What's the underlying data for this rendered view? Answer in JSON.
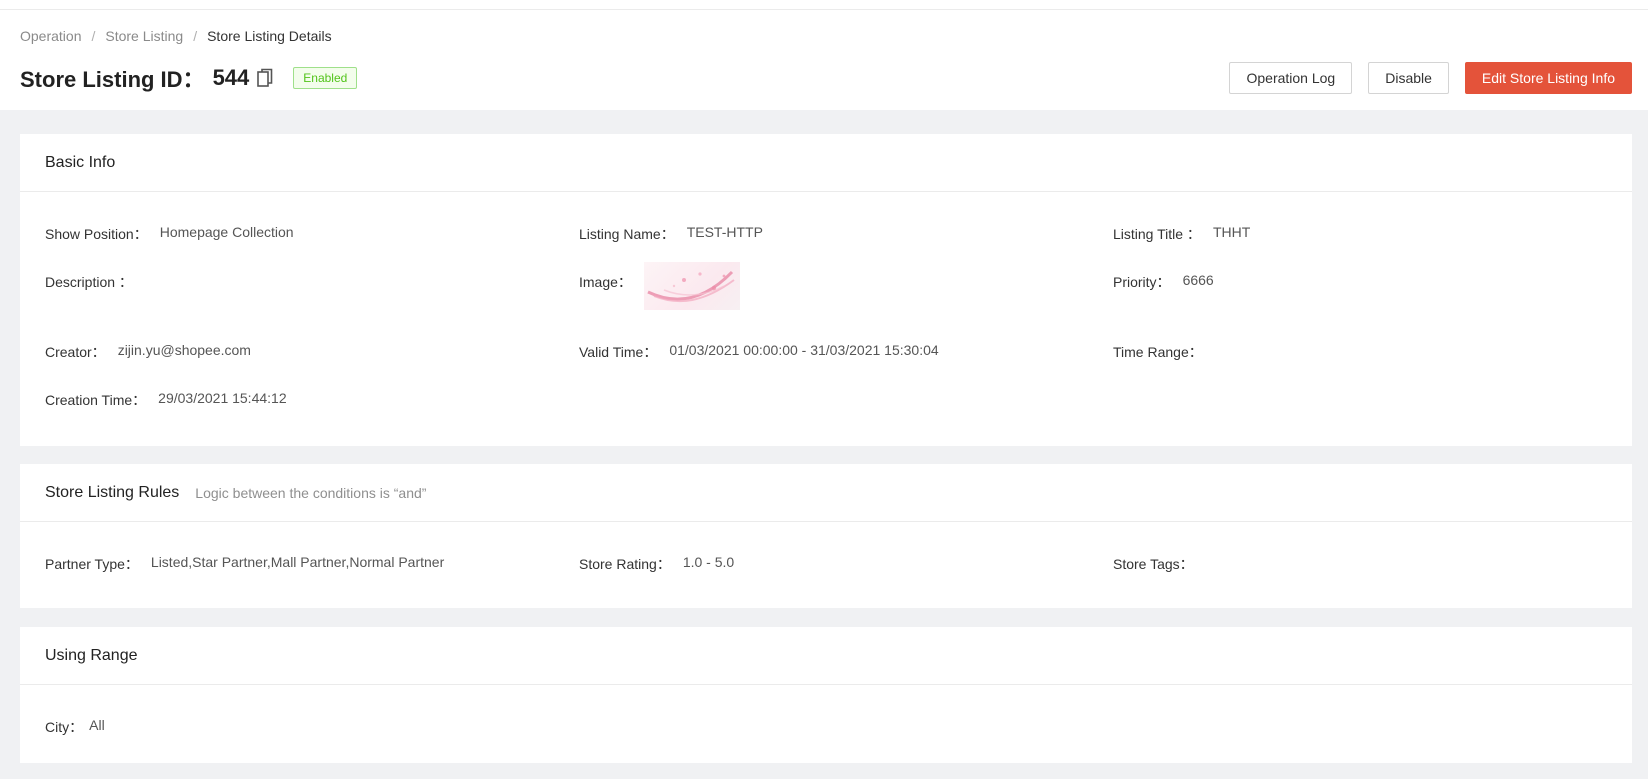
{
  "breadcrumb": {
    "items": [
      "Operation",
      "Store Listing"
    ],
    "separator": "/",
    "current": "Store Listing Details"
  },
  "header": {
    "title_label": "Store Listing ID：",
    "listing_id": "544",
    "status": "Enabled",
    "actions": {
      "operation_log": "Operation Log",
      "disable": "Disable",
      "edit": "Edit Store Listing Info"
    }
  },
  "basic_info": {
    "title": "Basic Info",
    "fields": {
      "show_position": {
        "label": "Show Position：",
        "value": "Homepage Collection"
      },
      "listing_name": {
        "label": "Listing Name：",
        "value": "TEST-HTTP"
      },
      "listing_title": {
        "label": "Listing Title ：",
        "value": "THHT"
      },
      "description": {
        "label": "Description ：",
        "value": ""
      },
      "image": {
        "label": "Image：",
        "value": ""
      },
      "priority": {
        "label": "Priority：",
        "value": "6666"
      },
      "creator": {
        "label": "Creator：",
        "value": "zijin.yu@shopee.com"
      },
      "valid_time": {
        "label": "Valid Time：",
        "value": "01/03/2021 00:00:00 - 31/03/2021 15:30:04"
      },
      "time_range": {
        "label": "Time Range：",
        "value": ""
      },
      "creation_time": {
        "label": "Creation Time：",
        "value": "29/03/2021 15:44:12"
      }
    }
  },
  "rules": {
    "title": "Store Listing Rules",
    "subtitle": "Logic between the conditions is “and”",
    "fields": {
      "partner_type": {
        "label": "Partner Type：",
        "value": "Listed,Star Partner,Mall Partner,Normal Partner"
      },
      "store_rating": {
        "label": "Store Rating：",
        "value": "1.0 - 5.0"
      },
      "store_tags": {
        "label": "Store Tags：",
        "value": ""
      }
    }
  },
  "using_range": {
    "title": "Using Range",
    "fields": {
      "city": {
        "label": "City：",
        "value": "All"
      }
    }
  },
  "colors": {
    "primary": "#e4533a",
    "status_green": "#52c41a",
    "background": "#f0f1f3"
  }
}
